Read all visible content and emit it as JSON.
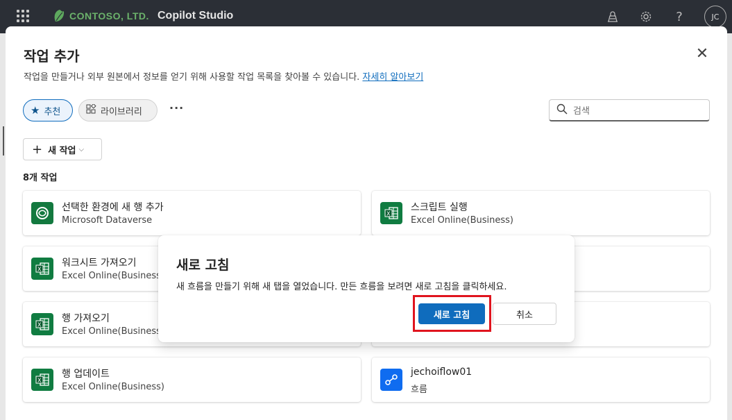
{
  "topbar": {
    "brand": "CONTOSO, LTD.",
    "app_title": "Copilot Studio",
    "avatar_initials": "JC"
  },
  "panel": {
    "title": "작업 추가",
    "description": "작업을 만들거나 외부 원본에서 정보를 얻기 위해 사용할 작업 목록을 찾아볼 수 있습니다.",
    "learn_more": "자세히 알아보기",
    "tabs": [
      {
        "label": "추천",
        "icon": "star-icon",
        "selected": true
      },
      {
        "label": "라이브러리",
        "icon": "library-icon",
        "selected": false
      }
    ],
    "more_label": "···",
    "search_placeholder": "검색",
    "new_action_label": "새 작업",
    "count_label": "8개 작업",
    "cards": [
      {
        "name": "선택한 환경에 새 행 추가",
        "source": "Microsoft Dataverse",
        "icon": "dataverse-icon"
      },
      {
        "name": "스크립트 실행",
        "source": "Excel Online(Business)",
        "icon": "excel-icon"
      },
      {
        "name": "워크시트 가져오기",
        "source": "Excel Online(Business)",
        "icon": "excel-icon"
      },
      {
        "name": "행 가져오기",
        "source": "Excel Online(Business)",
        "icon": "excel-icon"
      },
      {
        "name": "행 업데이트",
        "source": "Excel Online(Business)",
        "icon": "excel-icon"
      },
      {
        "name": "jechoiflow01",
        "source": "흐름",
        "icon": "flow-icon"
      }
    ]
  },
  "dialog": {
    "title": "새로 고침",
    "body": "새 흐름을 만들기 위해 새 탭을 열었습니다. 만든 흐름을 보려면 새로 고침을 클릭하세요.",
    "primary_label": "새로 고침",
    "secondary_label": "취소"
  },
  "colors": {
    "accent": "#0f6cbd",
    "highlight": "#e0141e",
    "excel": "#107c41",
    "flow": "#0f6cf0"
  }
}
